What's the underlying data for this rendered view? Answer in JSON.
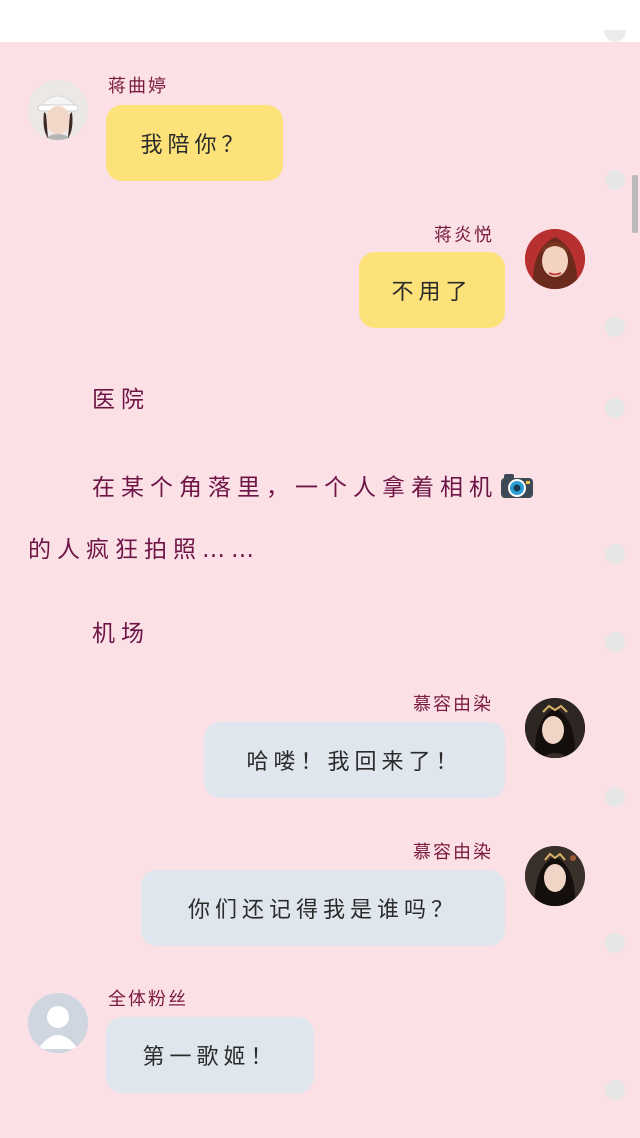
{
  "messages": [
    {
      "speaker": "蒋曲婷",
      "text": "我陪你？"
    },
    {
      "speaker": "蒋炎悦",
      "text": "不用了"
    },
    {
      "speaker": "慕容由染",
      "text": "哈喽！我回来了！"
    },
    {
      "speaker": "慕容由染",
      "text": "你们还记得我是谁吗？"
    },
    {
      "speaker": "全体粉丝",
      "text": "第一歌姬！"
    }
  ],
  "narration": {
    "scene1": "医院",
    "line1": "在某个角落里，一个人拿着相机",
    "line2": "的人疯狂拍照……",
    "scene2": "机场"
  },
  "icons": {
    "camera": "camera-emoji",
    "default_avatar": "person-silhouette-icon"
  },
  "colors": {
    "background": "#fbe1e6",
    "yellow_bubble": "#fde27a",
    "blue_bubble": "#dfe6ee",
    "name_text": "#7a1a3e"
  }
}
